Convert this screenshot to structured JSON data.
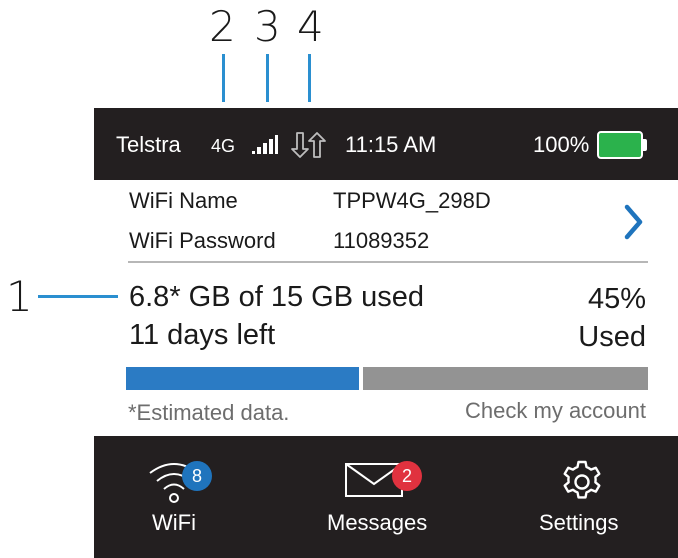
{
  "callouts": {
    "one": "1",
    "two": "2",
    "three": "3",
    "four": "4",
    "line_color": "#2a8fd0"
  },
  "status_bar": {
    "carrier": "Telstra",
    "network": "4G",
    "signal_icon": "signal-bars-icon",
    "data_transfer_icon": "data-arrows-icon",
    "time": "11:15 AM",
    "battery_percent": "100%",
    "battery_color": "#2bb24c",
    "background": "#231f20"
  },
  "wifi_info": {
    "name_label": "WiFi Name",
    "name_value": "TPPW4G_298D",
    "password_label": "WiFi Password",
    "password_value": "11089352",
    "chevron_icon": "chevron-right-icon",
    "accent": "#1f74bd"
  },
  "usage": {
    "summary": "6.8* GB of 15 GB used",
    "days_left": "11 days left",
    "percent": "45%",
    "used_label": "Used",
    "used_fraction": 0.45,
    "used_color": "#2b7bc4",
    "remaining_color": "#939393",
    "footnote": "*Estimated data.",
    "account_link": "Check my account"
  },
  "nav": {
    "wifi": {
      "label": "WiFi",
      "icon": "wifi-icon",
      "badge": "8",
      "badge_color": "#1f74bd"
    },
    "messages": {
      "label": "Messages",
      "icon": "envelope-icon",
      "badge": "2",
      "badge_color": "#e0323f"
    },
    "settings": {
      "label": "Settings",
      "icon": "gear-icon"
    }
  }
}
